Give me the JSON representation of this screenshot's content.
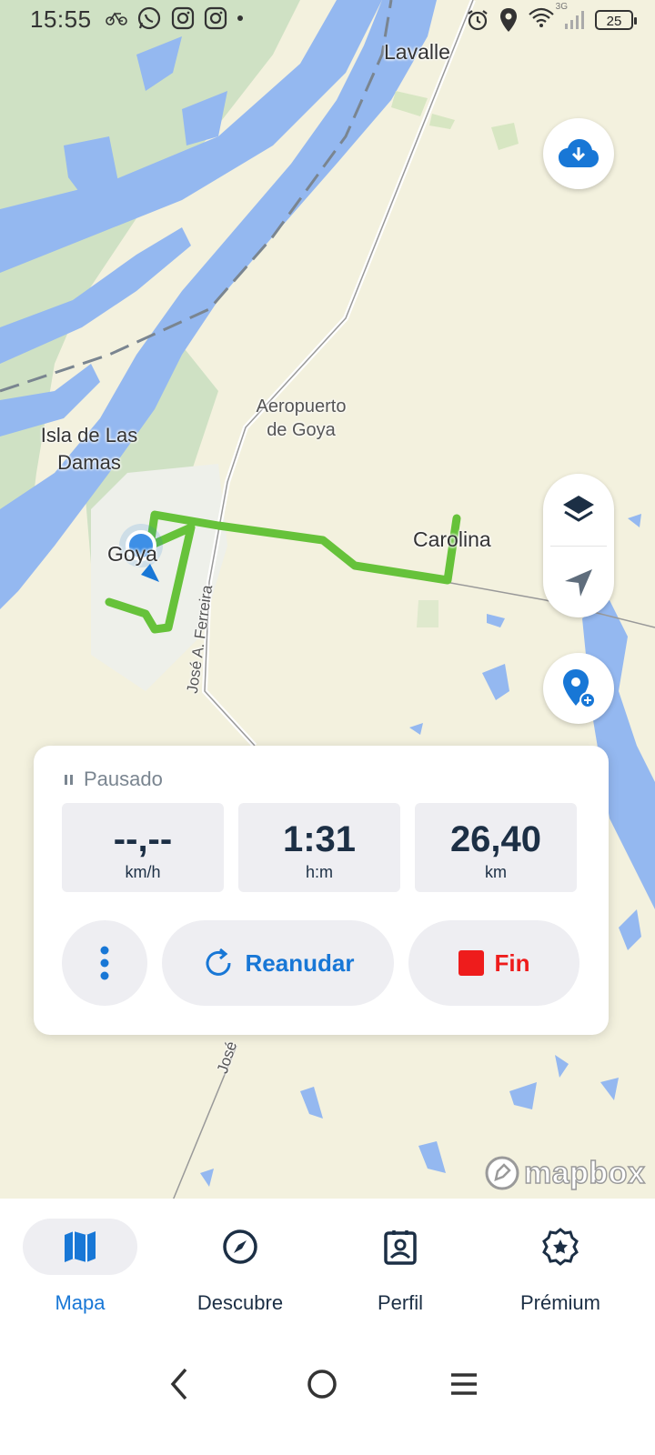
{
  "status_bar": {
    "time": "15:55",
    "network": "3G",
    "battery": "25"
  },
  "map": {
    "labels": {
      "lavalle": "Lavalle",
      "isla_line1": "Isla de Las",
      "isla_line2": "Damas",
      "aero_line1": "Aeropuerto",
      "aero_line2": "de Goya",
      "carolina": "Carolina",
      "goya": "Goya",
      "road_ferreira": "José A. Ferreira",
      "road_jose": "José"
    },
    "attribution": "mapbox"
  },
  "tracking_card": {
    "status": "Pausado",
    "stats": [
      {
        "value": "--,--",
        "unit": "km/h"
      },
      {
        "value": "1:31",
        "unit": "h:m"
      },
      {
        "value": "26,40",
        "unit": "km"
      }
    ],
    "resume_label": "Reanudar",
    "end_label": "Fin"
  },
  "bottom_nav": {
    "tabs": [
      {
        "label": "Mapa",
        "active": true
      },
      {
        "label": "Descubre",
        "active": false
      },
      {
        "label": "Perfil",
        "active": false
      },
      {
        "label": "Prémium",
        "active": false
      }
    ]
  },
  "colors": {
    "accent": "#1877d6",
    "water": "#94b8f0",
    "land_green": "#cfe1c4",
    "land": "#f3f1de",
    "route": "#66c23a",
    "stop": "#ee1c1c",
    "text_dark": "#1c2f45"
  }
}
